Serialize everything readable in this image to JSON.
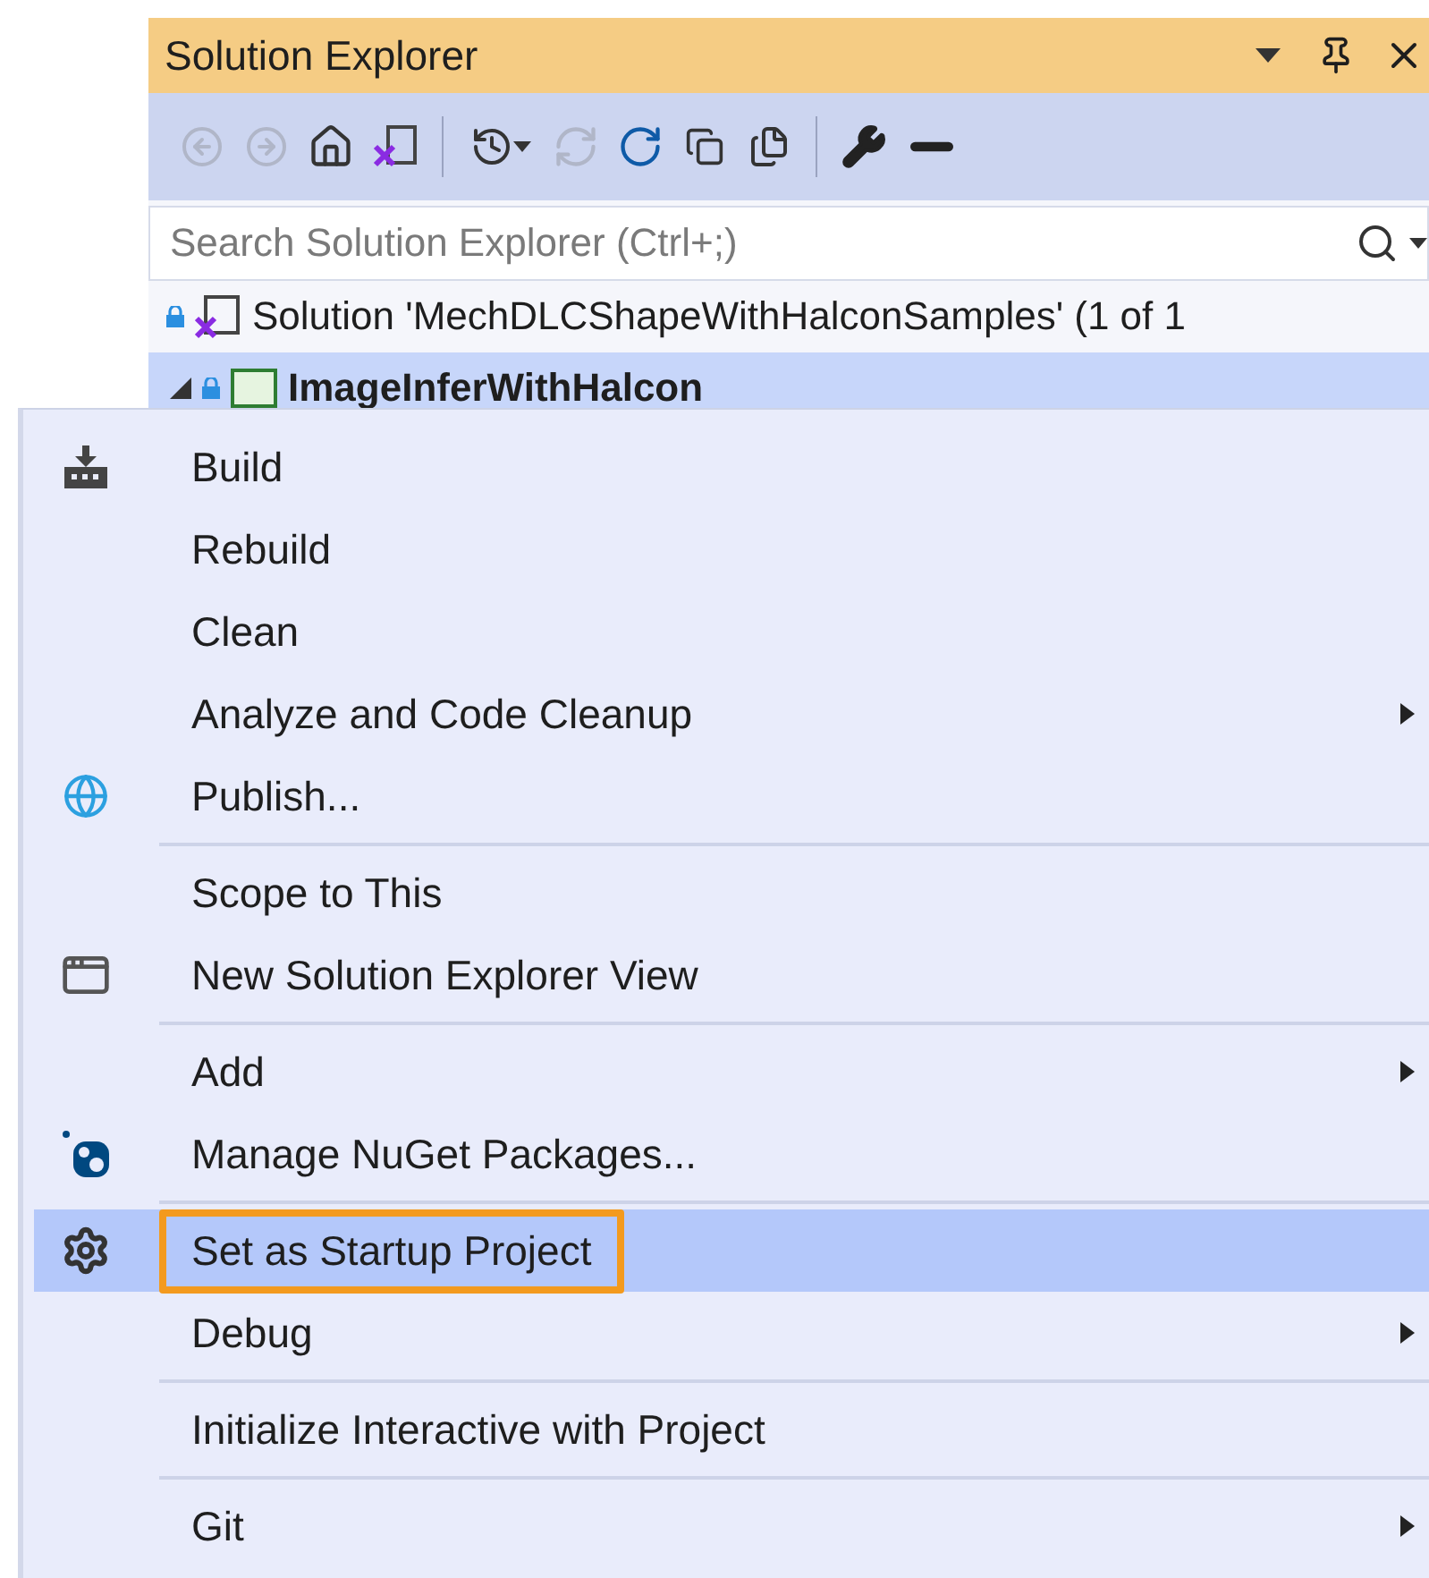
{
  "panel": {
    "title": "Solution Explorer",
    "toolbar": [
      {
        "kind": "back",
        "disabled": true
      },
      {
        "kind": "forward",
        "disabled": true
      },
      {
        "kind": "home",
        "disabled": false
      },
      {
        "kind": "vs-view",
        "disabled": false
      },
      {
        "kind": "separator"
      },
      {
        "kind": "history",
        "disabled": false
      },
      {
        "kind": "sync",
        "disabled": true
      },
      {
        "kind": "refresh",
        "disabled": false
      },
      {
        "kind": "collapse",
        "disabled": false
      },
      {
        "kind": "show-files",
        "disabled": false
      },
      {
        "kind": "separator"
      },
      {
        "kind": "properties",
        "disabled": false
      },
      {
        "kind": "preview",
        "disabled": false
      }
    ],
    "search": {
      "placeholder": "Search Solution Explorer (Ctrl+;)"
    },
    "tree": [
      {
        "kind": "solution",
        "label": "Solution 'MechDLCShapeWithHalconSamples' (1 of 1",
        "selected": false
      },
      {
        "kind": "project",
        "label": "ImageInferWithHalcon",
        "selected": true,
        "expanded": true
      }
    ]
  },
  "menu": [
    {
      "kind": "item",
      "label": "Build",
      "submenu": false,
      "selected": false,
      "outlined": false
    },
    {
      "kind": "item",
      "label": "Rebuild",
      "submenu": false,
      "selected": false,
      "outlined": false
    },
    {
      "kind": "item",
      "label": "Clean",
      "submenu": false,
      "selected": false,
      "outlined": false
    },
    {
      "kind": "item",
      "label": "Analyze and Code Cleanup",
      "submenu": true,
      "selected": false,
      "outlined": false
    },
    {
      "kind": "item",
      "label": "Publish...",
      "submenu": false,
      "selected": false,
      "outlined": false
    },
    {
      "kind": "separator"
    },
    {
      "kind": "item",
      "label": "Scope to This",
      "submenu": false,
      "selected": false,
      "outlined": false
    },
    {
      "kind": "item",
      "label": "New Solution Explorer View",
      "submenu": false,
      "selected": false,
      "outlined": false
    },
    {
      "kind": "separator"
    },
    {
      "kind": "item",
      "label": "Add",
      "submenu": true,
      "selected": false,
      "outlined": false
    },
    {
      "kind": "item",
      "label": "Manage NuGet Packages...",
      "submenu": false,
      "selected": false,
      "outlined": false
    },
    {
      "kind": "separator"
    },
    {
      "kind": "item",
      "label": "Set as Startup Project",
      "submenu": false,
      "selected": true,
      "outlined": true
    },
    {
      "kind": "item",
      "label": "Debug",
      "submenu": true,
      "selected": false,
      "outlined": false
    },
    {
      "kind": "separator"
    },
    {
      "kind": "item",
      "label": "Initialize Interactive with Project",
      "submenu": false,
      "selected": false,
      "outlined": false
    },
    {
      "kind": "separator"
    },
    {
      "kind": "item",
      "label": "Git",
      "submenu": true,
      "selected": false,
      "outlined": false
    }
  ]
}
